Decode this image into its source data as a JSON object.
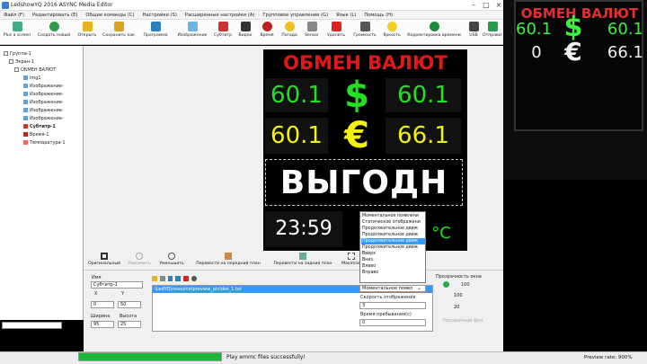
{
  "window": {
    "title": "LedshowYQ 2016 ASYNC Media Editor"
  },
  "menu": [
    "Файл (F)",
    "Редактировать (E)",
    "Общие команды (C)",
    "Настройки (S)",
    "Расширенные настройки (A)",
    "Групповое управление (G)",
    "Язык (L)",
    "Помощь (H)"
  ],
  "toolbar": [
    "Plus a screen",
    "Создать новый",
    "Открыть",
    "Сохранить как",
    "Программа",
    "Изображение",
    "Субтитр",
    "Видео",
    "Время",
    "Погода",
    "Sensor",
    "Удалить",
    "Громкость",
    "Яркость",
    "Корректировка времени",
    "USB",
    "Отправить"
  ],
  "tree": {
    "items": [
      {
        "label": "Группа-1"
      },
      {
        "label": "Экран-1"
      },
      {
        "label": "ОБМЕН ВАЛЮТ"
      },
      {
        "label": "img1"
      },
      {
        "label": "Изображение-"
      },
      {
        "label": "Изображение-"
      },
      {
        "label": "Изображение-"
      },
      {
        "label": "Изображение-"
      },
      {
        "label": "Изображение-"
      },
      {
        "label": "Субтитр-1"
      },
      {
        "label": "Время-1"
      },
      {
        "label": "Темпаратура-1"
      }
    ]
  },
  "led": {
    "title": "ОБМЕН ВАЛЮТ",
    "usd_buy": "60.1",
    "usd_sell": "60.1",
    "usd_symbol": "$",
    "eur_buy": "60.1",
    "eur_sell": "66.1",
    "eur_symbol": "€",
    "subtitle": "ВЫГОДН",
    "time": "23:59",
    "temp": "°C"
  },
  "scene": {
    "title": "ОБМЕН ВАЛЮТ",
    "usd_buy": "60.1",
    "usd_sell": "60.1",
    "usd_symbol": "$",
    "eur_buy": "0",
    "eur_sell": "66.1",
    "eur_symbol": "€"
  },
  "props_toolbar": [
    "Оригинальный",
    "Увеличить",
    "Уменьшить",
    "Перевести на передний план",
    "Перевести на задний план",
    "Maximize"
  ],
  "props": {
    "name_label": "Имя",
    "name_value": "Субтитр-1",
    "x_label": "X",
    "y_label": "Y",
    "x_value": "0",
    "y_value": "50",
    "width_label": "Ширина",
    "height_label": "Высота",
    "width_value": "95",
    "height_value": "25",
    "file_path": "\\LedYQ\\resource\\preview_pic\\dos_1.txt",
    "effect_value": "Моментальное появл",
    "speed_label": "Скорость отображения",
    "speed_value": "3",
    "stay_label": "Время пребывания(с)",
    "stay_value": "0",
    "transparency_label": "Прозрачность окна",
    "transparency_value": "100",
    "trans_100": "100",
    "trans_20": "20",
    "faded_label": "Прозрачный фон"
  },
  "dropdown": {
    "options": [
      "Моментальное появлени",
      "Статическое отображени",
      "Продолжительное движ",
      "Продолжительное движ",
      "Продолжительное движ",
      "Продолжительное движ",
      "Вверх",
      "Вниз",
      "Влево",
      "Вправо"
    ],
    "selected_index": 4
  },
  "status": {
    "message": "Play emmc files successfully!",
    "preview_rate": "Preview rate: 900%",
    "progress": 1.0
  },
  "colors": {
    "led_red": "#e01818",
    "led_green": "#22e022",
    "led_yellow": "#f2f20a",
    "led_white": "#ffffff",
    "progress": "#1db83a",
    "selection": "#3399ff"
  }
}
